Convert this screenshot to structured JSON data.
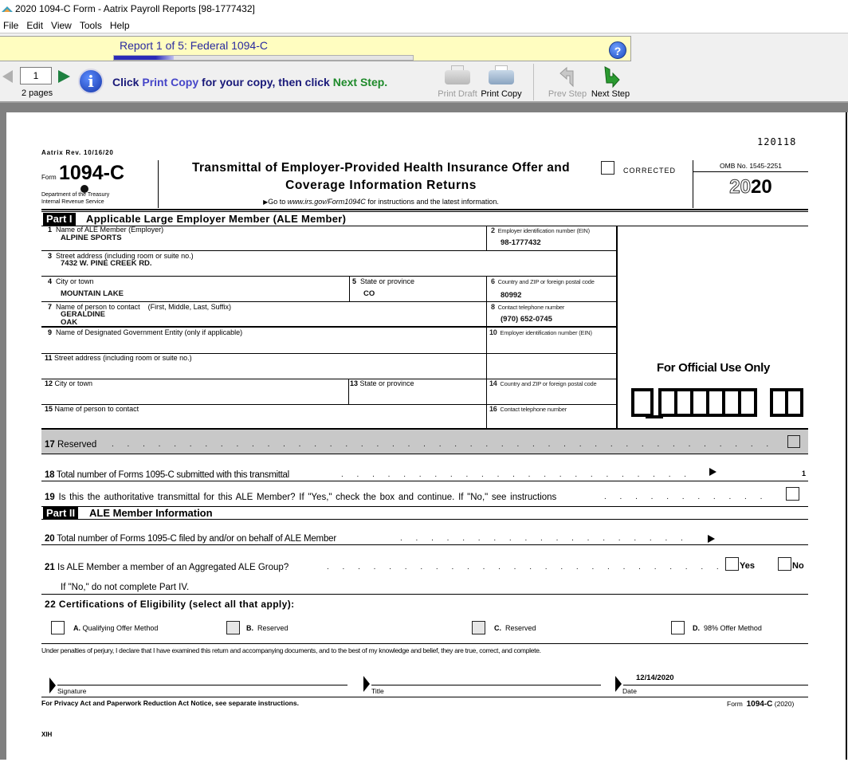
{
  "window": {
    "title": "2020 1094-C Form - Aatrix Payroll Reports [98-1777432]"
  },
  "menu": [
    "File",
    "Edit",
    "View",
    "Tools",
    "Help"
  ],
  "report": {
    "title": "Report 1 of 5: Federal 1094-C",
    "progress_fraction": 0.2
  },
  "toolbar": {
    "page_number": "1",
    "pages_label": "2 pages",
    "instruction_prefix": "Click",
    "instruction_print_copy": "Print Copy",
    "instruction_middle": "for your copy, then click",
    "instruction_next_step": "Next Step.",
    "print_draft": "Print Draft",
    "print_copy": "Print Copy",
    "prev_step": "Prev Step",
    "next_step": "Next Step",
    "help": "?"
  },
  "form": {
    "code": "120118",
    "revision": "Aatrix Rev. 10/16/20",
    "form_word": "Form",
    "form_number": "1094-C",
    "dept_line1": "Department of the Treasury",
    "dept_line2": "Internal Revenue Service",
    "title_line1": "Transmittal of Employer-Provided Health Insurance Offer and",
    "title_line2": "Coverage Information Returns",
    "goto_prefix": "Go to",
    "goto_url": "www.irs.gov/Form1094C",
    "goto_suffix": "for instructions and the latest information.",
    "corrected_label": "CORRECTED",
    "omb": "OMB No. 1545-2251",
    "year_outline": "20",
    "year_bold": "20",
    "part1_tag": "Part I",
    "part1_title": "Applicable Large Employer Member (ALE Member)",
    "fields": {
      "f1": {
        "num": "1",
        "label": "Name of ALE Member (Employer)",
        "value": "ALPINE SPORTS"
      },
      "f2": {
        "num": "2",
        "label": "Employer identification number (EIN)",
        "value": "98-1777432"
      },
      "f3": {
        "num": "3",
        "label": "Street address (including room or suite no.)",
        "value": "7432 W. PINE CREEK RD."
      },
      "f4": {
        "num": "4",
        "label": "City or town",
        "value": "MOUNTAIN LAKE"
      },
      "f5": {
        "num": "5",
        "label": "State or province",
        "value": "CO"
      },
      "f6": {
        "num": "6",
        "label": "Country and ZIP or foreign postal code",
        "value": "80992"
      },
      "f7": {
        "num": "7",
        "label": "Name of person to contact",
        "label_extra": "(First, Middle, Last, Suffix)",
        "value1": "GERALDINE",
        "value2": "OAK"
      },
      "f8": {
        "num": "8",
        "label": "Contact telephone number",
        "value": "(970) 652-0745"
      },
      "f9": {
        "num": "9",
        "label": "Name of Designated Government Entity (only if applicable)",
        "value": ""
      },
      "f10": {
        "num": "10",
        "label": "Employer identification number (EIN)",
        "value": ""
      },
      "f11": {
        "num": "11",
        "label": "Street address (including room or suite no.)",
        "value": ""
      },
      "f12": {
        "num": "12",
        "label": "City or town",
        "value": ""
      },
      "f13": {
        "num": "13",
        "label": "State or province",
        "value": ""
      },
      "f14": {
        "num": "14",
        "label": "Country and ZIP or foreign postal code",
        "value": ""
      },
      "f15": {
        "num": "15",
        "label": "Name of person to contact",
        "value": ""
      },
      "f16": {
        "num": "16",
        "label": "Contact telephone number",
        "value": ""
      }
    },
    "official_use": "For Official Use Only",
    "line17": {
      "num": "17",
      "label": "Reserved"
    },
    "line18": {
      "num": "18",
      "label": "Total number of Forms 1095-C submitted with this transmittal",
      "value": "1"
    },
    "line19": {
      "num": "19",
      "label": "Is this the authoritative transmittal for this ALE Member? If \"Yes,\" check the box and continue. If \"No,\" see instructions",
      "checked": false
    },
    "part2_tag": "Part II",
    "part2_title": "ALE Member Information",
    "line20": {
      "num": "20",
      "label": "Total number of Forms 1095-C filed by and/or on behalf of ALE Member",
      "value": ""
    },
    "line21": {
      "num": "21",
      "label": "Is ALE Member a member of an Aggregated ALE Group?",
      "yes": "Yes",
      "no": "No",
      "note": "If \"No,\" do not complete Part IV."
    },
    "line22": {
      "num": "22",
      "label": "Certifications of Eligibility (select all that apply):",
      "options": [
        {
          "letter": "A.",
          "label": "Qualifying Offer Method"
        },
        {
          "letter": "B.",
          "label": "Reserved"
        },
        {
          "letter": "C.",
          "label": "Reserved"
        },
        {
          "letter": "D.",
          "label": "98% Offer Method"
        }
      ]
    },
    "perjury": "Under penalties of perjury, I declare that I have examined this return and accompanying documents, and to the best of my knowledge and belief, they are true, correct, and complete.",
    "signature_label": "Signature",
    "title_label": "Title",
    "date_label": "Date",
    "date_value": "12/14/2020",
    "privacy": "For Privacy Act and Paperwork Reduction Act Notice, see separate instructions.",
    "footer_form": "Form",
    "footer_number": "1094-C",
    "footer_year": "(2020)",
    "bottom_code": "XIH"
  }
}
